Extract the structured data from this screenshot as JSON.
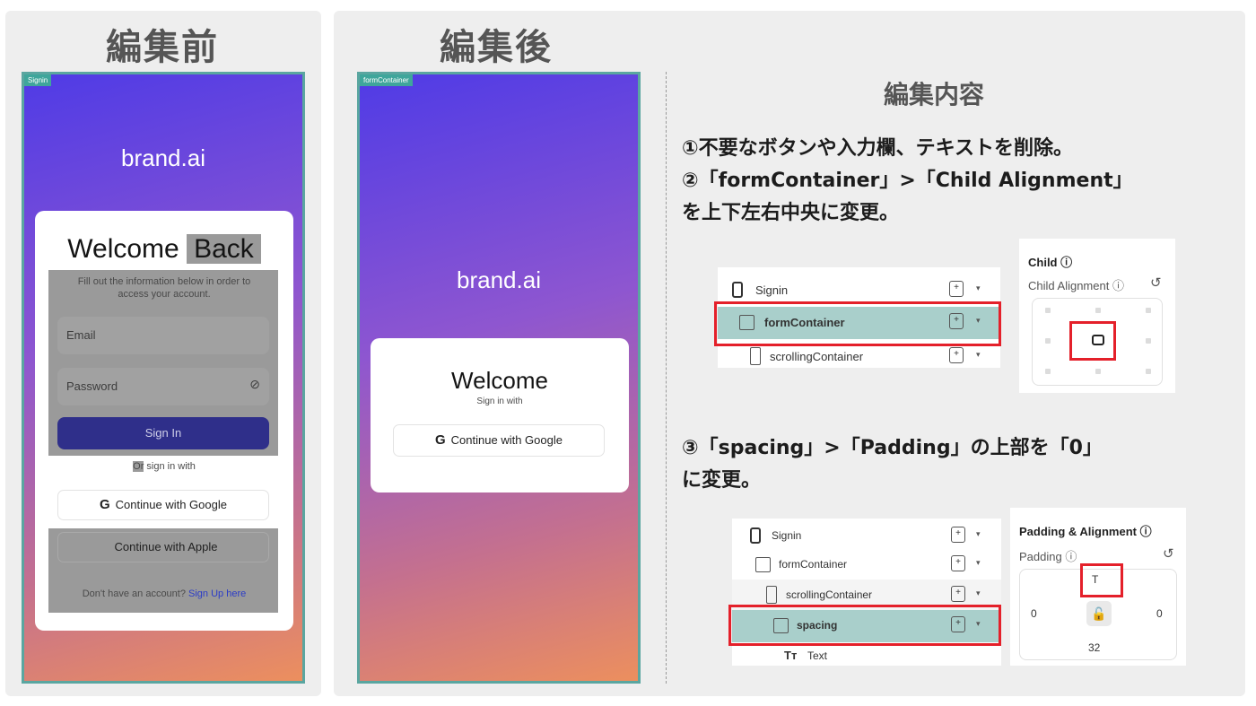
{
  "headings": {
    "before": "編集前",
    "after": "編集後",
    "edit_content": "編集内容"
  },
  "before_screen": {
    "tag": "Signin",
    "brand": "brand.ai",
    "welcome_prefix": "Welcome ",
    "welcome_back": "Back",
    "subtitle": "Fill out the information below in order to access your account.",
    "email_placeholder": "Email",
    "password_placeholder": "Password",
    "eye_icon": "eye-off",
    "sign_in": "Sign In",
    "or_prefix": "Or",
    "or_suffix": " sign in with",
    "google_glyph": "G",
    "google_label": "Continue with Google",
    "apple_glyph": "",
    "apple_label": "Continue with Apple",
    "no_account": "Don't have an account? ",
    "sign_up": "Sign Up here"
  },
  "after_screen": {
    "tag": "formContainer",
    "brand": "brand.ai",
    "welcome": "Welcome",
    "sign_in_with": "Sign in with",
    "google_glyph": "G",
    "google_label": "Continue with Google"
  },
  "steps": {
    "step1": "①不要なボタンや入力欄、テキストを削除。",
    "step2_line1": "②「formContainer」>「Child Alignment」",
    "step2_line2": "を上下左右中央に変更。",
    "step3_line1": "③「spacing」>「Padding」の上部を「0」",
    "step3_line2": "に変更。"
  },
  "tree1": {
    "rows": [
      {
        "label": "Signin"
      },
      {
        "label": "formContainer"
      },
      {
        "label": "scrollingContainer"
      }
    ],
    "add_glyph": "+",
    "caret": "▾"
  },
  "child_panel": {
    "title": "Child ⓘ",
    "subtitle": "Child Alignment ⓘ",
    "reset": "↺"
  },
  "tree2": {
    "rows": [
      {
        "label": "Signin"
      },
      {
        "label": "formContainer"
      },
      {
        "label": "scrollingContainer"
      },
      {
        "label": "spacing"
      },
      {
        "label": "Text"
      }
    ],
    "text_glyph": "Tт",
    "add_glyph": "+",
    "caret": "▾"
  },
  "padding_panel": {
    "title": "Padding & Alignment ⓘ",
    "subtitle": "Padding ⓘ",
    "reset": "↺",
    "top": "T",
    "left": "0",
    "right": "0",
    "bottom": "32",
    "lock_glyph": "🔓"
  },
  "colors": {
    "highlight_red": "#e4202a",
    "selected_row": "#a9cfcb",
    "frame_teal": "#5aa6a0"
  }
}
